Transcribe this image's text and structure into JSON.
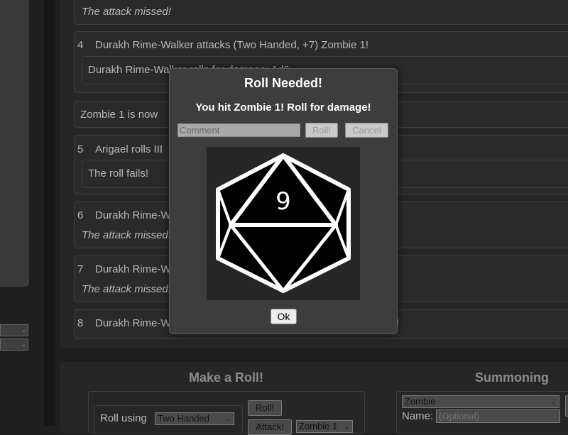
{
  "log": {
    "entries": [
      {
        "italic_result": "The attack missed!"
      },
      {
        "number": "4",
        "title": "Durakh Rime-Walker attacks (Two Handed, +7) Zombie 1!",
        "result": "Durakh Rime-Walker rolls for damage: 1d6"
      },
      {
        "title": "Zombie 1 is now"
      },
      {
        "number": "5",
        "title": "Arigael rolls III",
        "result": "The roll fails!"
      },
      {
        "number": "6",
        "title": "Durakh Rime-Walker",
        "italic_result": "The attack missed!"
      },
      {
        "number": "7",
        "title": "Durakh Rime-Walker",
        "italic_result": "The attack missed!"
      },
      {
        "number": "8",
        "title": "Durakh Rime-Walker",
        "tail": "!"
      }
    ]
  },
  "make_roll": {
    "heading": "Make a Roll!",
    "roll_using_label": "Roll using",
    "roll_using_value": "Two Handed",
    "roll_button": "Roll!",
    "attack_button": "Attack!",
    "target_value": "Zombie 1"
  },
  "summoning": {
    "heading": "Summoning",
    "creature_value": "Zombie",
    "name_label": "Name:",
    "name_placeholder": "(Optional)"
  },
  "modal": {
    "title": "Roll Needed!",
    "subtitle": "You hit Zombie 1! Roll for damage!",
    "comment_placeholder": "Comment",
    "roll_button": "Roll!",
    "cancel_button": "Cancel",
    "die_value": "9",
    "die_icon": "d20-icon",
    "ok_button": "Ok"
  },
  "colors": {
    "background": "#1f1f1f",
    "modal_background": "#3d3d3d",
    "modal_text": "#ffffff",
    "die_fill": "#000000",
    "die_stroke": "#ffffff"
  }
}
